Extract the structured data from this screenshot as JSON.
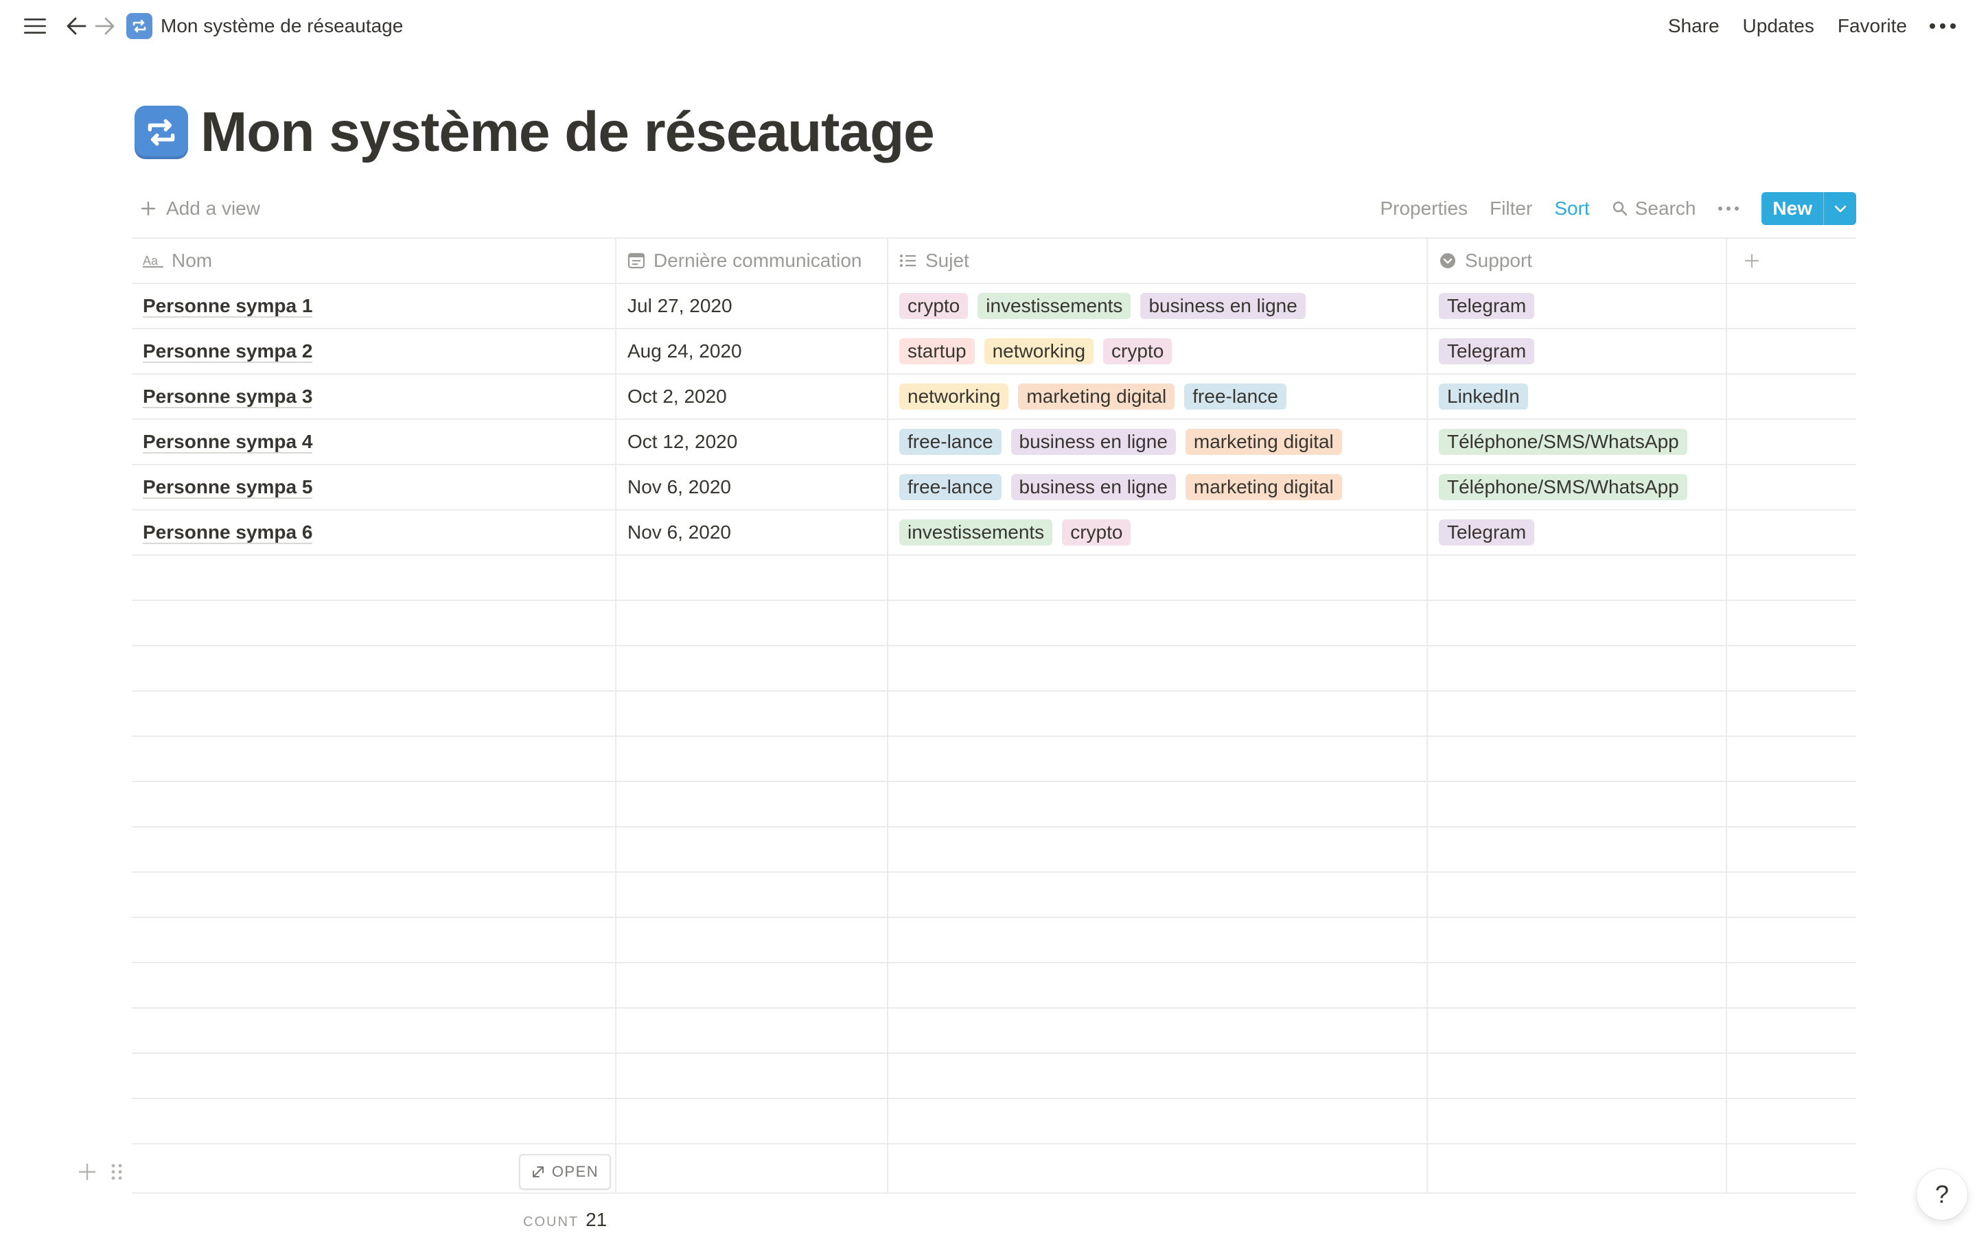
{
  "topbar": {
    "breadcrumb_title": "Mon système de réseautage",
    "share": "Share",
    "updates": "Updates",
    "favorite": "Favorite"
  },
  "page": {
    "title": "Mon système de réseautage",
    "icon": "repeat-arrows-icon"
  },
  "viewbar": {
    "add_view": "Add a view",
    "properties": "Properties",
    "filter": "Filter",
    "sort": "Sort",
    "search": "Search",
    "new": "New"
  },
  "colors": {
    "accent": "#2eaadc",
    "text": "#37352f",
    "muted": "#9b9a97",
    "border": "#ebebea"
  },
  "tag_colors": {
    "crypto": "#f5e0e9",
    "investissements": "#dbeddb",
    "business en ligne": "#e8deee",
    "startup": "#ffe2dd",
    "networking": "#fdecc8",
    "marketing digital": "#fadec9",
    "free-lance": "#d3e5ef",
    "Telegram": "#e8deee",
    "LinkedIn": "#d3e5ef",
    "Téléphone/SMS/WhatsApp": "#dbeddb"
  },
  "table": {
    "columns": [
      "Nom",
      "Dernière communication",
      "Sujet",
      "Support"
    ],
    "rows": [
      {
        "name": "Personne sympa 1",
        "date": "Jul 27, 2020",
        "tags": [
          "crypto",
          "investissements",
          "business en ligne"
        ],
        "support": "Telegram"
      },
      {
        "name": "Personne sympa 2",
        "date": "Aug 24, 2020",
        "tags": [
          "startup",
          "networking",
          "crypto"
        ],
        "support": "Telegram"
      },
      {
        "name": "Personne sympa 3",
        "date": "Oct 2, 2020",
        "tags": [
          "networking",
          "marketing digital",
          "free-lance"
        ],
        "support": "LinkedIn"
      },
      {
        "name": "Personne sympa 4",
        "date": "Oct 12, 2020",
        "tags": [
          "free-lance",
          "business en ligne",
          "marketing digital"
        ],
        "support": "Téléphone/SMS/WhatsApp"
      },
      {
        "name": "Personne sympa 5",
        "date": "Nov 6, 2020",
        "tags": [
          "free-lance",
          "business en ligne",
          "marketing digital"
        ],
        "support": "Téléphone/SMS/WhatsApp"
      },
      {
        "name": "Personne sympa 6",
        "date": "Nov 6, 2020",
        "tags": [
          "investissements",
          "crypto"
        ],
        "support": "Telegram"
      }
    ],
    "open_label": "OPEN",
    "count_label": "COUNT",
    "count_value": "21"
  },
  "help": "?"
}
